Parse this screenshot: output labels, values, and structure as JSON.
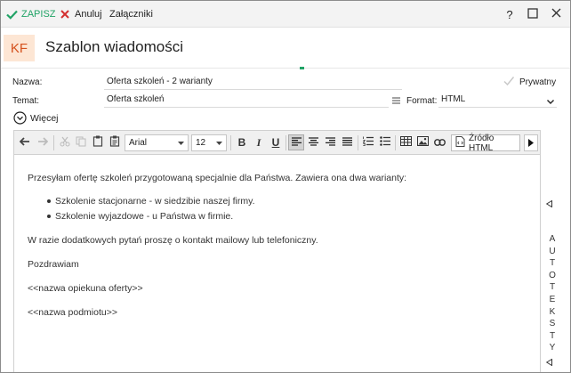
{
  "toolbar": {
    "save_label": "ZAPISZ",
    "cancel_label": "Anuluj",
    "attachments_label": "Załączniki",
    "help_label": "?"
  },
  "header": {
    "badge": "KF",
    "title": "Szablon wiadomości"
  },
  "form": {
    "name_label": "Nazwa:",
    "name_value": "Oferta szkoleń - 2 warianty",
    "private_label": "Prywatny",
    "subject_label": "Temat:",
    "subject_value": "Oferta szkoleń",
    "format_label": "Format:",
    "format_value": "HTML",
    "more_label": "Więcej"
  },
  "editor": {
    "font_value": "Arial",
    "size_value": "12",
    "bold_label": "B",
    "italic_label": "I",
    "underline_label": "U",
    "source_label": "Źródło HTML"
  },
  "body": {
    "p1": "Przesyłam ofertę szkoleń przygotowaną specjalnie dla Państwa. Zawiera ona dwa warianty:",
    "items": [
      "Szkolenie stacjonarne - w siedzibie naszej firmy.",
      "Szkolenie wyjazdowe - u Państwa w firmie."
    ],
    "p2": "W razie dodatkowych pytań proszę o kontakt mailowy lub telefoniczny.",
    "p3": "Pozdrawiam",
    "p4": "<<nazwa opiekuna oferty>>",
    "p5": "<<nazwa podmiotu>>"
  },
  "side_panel": {
    "label": "AUTOTEKSTY"
  },
  "colors": {
    "accent_green": "#21a366",
    "cancel_red": "#d32f2f",
    "badge_bg": "#fde6d4",
    "badge_text": "#d4511d"
  }
}
